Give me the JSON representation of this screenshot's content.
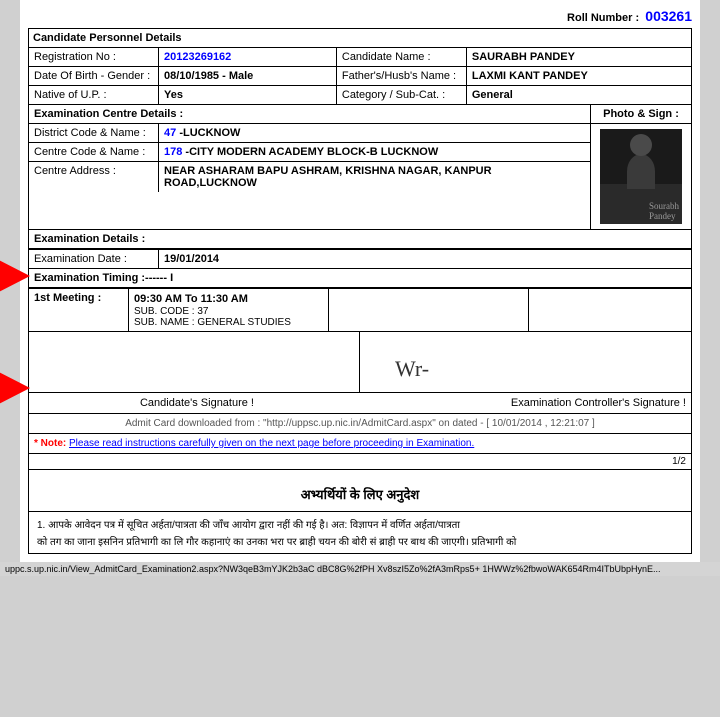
{
  "page": {
    "roll_number_label": "Roll Number :",
    "roll_number": "003261",
    "candidate_section_title": "Candidate Personnel Details",
    "fields": {
      "reg_no_label": "Registration No :",
      "reg_no": "20123269162",
      "candidate_name_label": "Candidate Name :",
      "candidate_name": "SAURABH PANDEY",
      "dob_label": "Date Of Birth - Gender :",
      "dob": "08/10/1985 - Male",
      "fathers_name_label": "Father's/Husb's Name :",
      "fathers_name": "LAXMI KANT PANDEY",
      "native_label": "Native of U.P. :",
      "native": "Yes",
      "category_label": "Category / Sub-Cat. :",
      "category": "General"
    },
    "exam_centre_title": "Examination Centre Details :",
    "photo_sign_label": "Photo & Sign :",
    "centre_fields": {
      "district_label": "District Code & Name :",
      "district_code": "47",
      "district_name": "-LUCKNOW",
      "centre_code_label": "Centre Code & Name :",
      "centre_code": "178",
      "centre_name": "-CITY MODERN ACADEMY BLOCK-B LUCKNOW",
      "address_label": "Centre Address :",
      "address": "NEAR ASHARAM BAPU ASHRAM, KRISHNA NAGAR, KANPUR ROAD,LUCKNOW"
    },
    "exam_details_title": "Examination Details :",
    "exam_date_label": "Examination Date :",
    "exam_date": "19/01/2014",
    "exam_timing_title": "Examination Timing :------ I",
    "meeting_label": "1st Meeting :",
    "meeting_time": "09:30 AM To 11:30 AM",
    "sub_code_label": "SUB. CODE : 37",
    "sub_name_label": "SUB. NAME : GENERAL STUDIES",
    "candidate_sig_label": "Candidate's Signature !",
    "controller_sig_label": "Examination Controller's Signature !",
    "controller_sig_text": "Wr-",
    "footer_url": "http://uppsc.up.nic.in/AdmitCard.aspx",
    "footer_text": "Admit Card downloaded from : \"http://uppsc.up.nic.in/AdmitCard.aspx\" on dated - [ 10/01/2014 , 12:21:07 ]",
    "note_label": "* Note:",
    "note_text": "Please read instructions carefully given on the next page before proceeding in Examination.",
    "page_number": "1/2",
    "hindi_title": "अभ्यर्थियों के लिए अनुदेश",
    "instruction_1": "1.  आपके आवेदन पत्र में सूचित अर्हता/पात्रता की जाँच आयोग द्वारा नहीं की गई है। अत: विज्ञापन में वर्णित अर्हता/पात्रता",
    "instruction_2": "को तग का जाना इसनिन प्रतिभागी का लि गौर कहानाएं का उनका भरा पर ब्राही चयन की बोरी सं ब्राही पर बाथ की जाएगी। प्रतिभागी को",
    "bottom_bar": "uppc.s.up.nic.in/View_AdmitCard_Examination2.aspx?NW3qeB3mYJK2b3aC dBC8G%2fPH Xv8szI5Zo%2fA3mRps5+ 1HWWz%2fbwoWAK654Rm4ITbUbpHynE..."
  }
}
